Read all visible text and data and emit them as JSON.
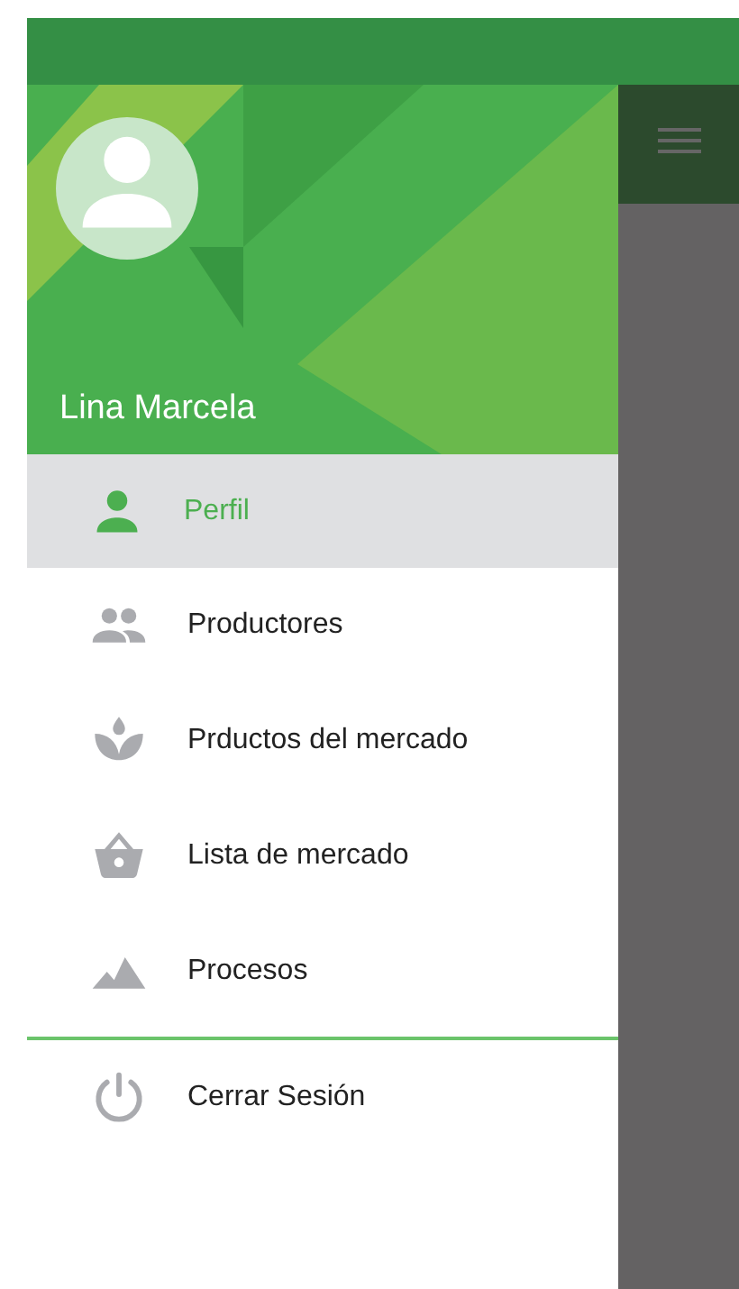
{
  "drawer": {
    "user_name": "Lina Marcela",
    "menu": [
      {
        "label": "Perfil",
        "selected": true
      },
      {
        "label": "Productores",
        "selected": false
      },
      {
        "label": "Prductos del mercado",
        "selected": false
      },
      {
        "label": "Lista de mercado",
        "selected": false
      },
      {
        "label": "Procesos",
        "selected": false
      }
    ],
    "footer": [
      {
        "label": "Cerrar Sesión",
        "selected": false
      }
    ]
  }
}
